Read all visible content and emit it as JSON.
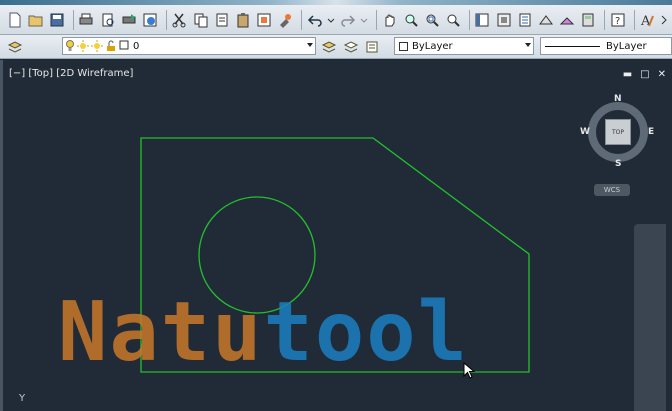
{
  "toolbar": {
    "row1_icons": [
      "new-icon",
      "open-icon",
      "save-icon",
      "plot-icon",
      "plot-preview-icon",
      "publish-icon",
      "3d-dwf-icon",
      "cut-icon",
      "copy-icon",
      "copy-basepoint-icon",
      "paste-icon",
      "paste-block-icon",
      "matchprop-icon",
      "undo-icon",
      "redo-icon",
      "pan-icon",
      "zoom-realtime-icon",
      "zoom-window-icon",
      "zoom-previous-icon",
      "properties-icon",
      "design-center-icon",
      "tool-palettes-icon",
      "sheet-set-icon",
      "markup-icon",
      "quickcalc-icon",
      "help-icon",
      "text-style-icon"
    ],
    "layer_value": "0",
    "color_value": "ByLayer",
    "linetype_value": "ByLayer"
  },
  "viewport": {
    "label": "[−] [Top] [2D Wireframe]",
    "controls": [
      "▬",
      "□",
      "✕"
    ]
  },
  "viewcube": {
    "top_label": "TOP",
    "north": "N",
    "south": "S",
    "east": "E",
    "west": "W",
    "wcs": "WCS"
  },
  "ucs": {
    "y_label": "Y"
  },
  "watermark": {
    "part1": "Natu",
    "part2": "tool"
  },
  "colors": {
    "geometry": "#22c02a",
    "background": "#212b37"
  }
}
